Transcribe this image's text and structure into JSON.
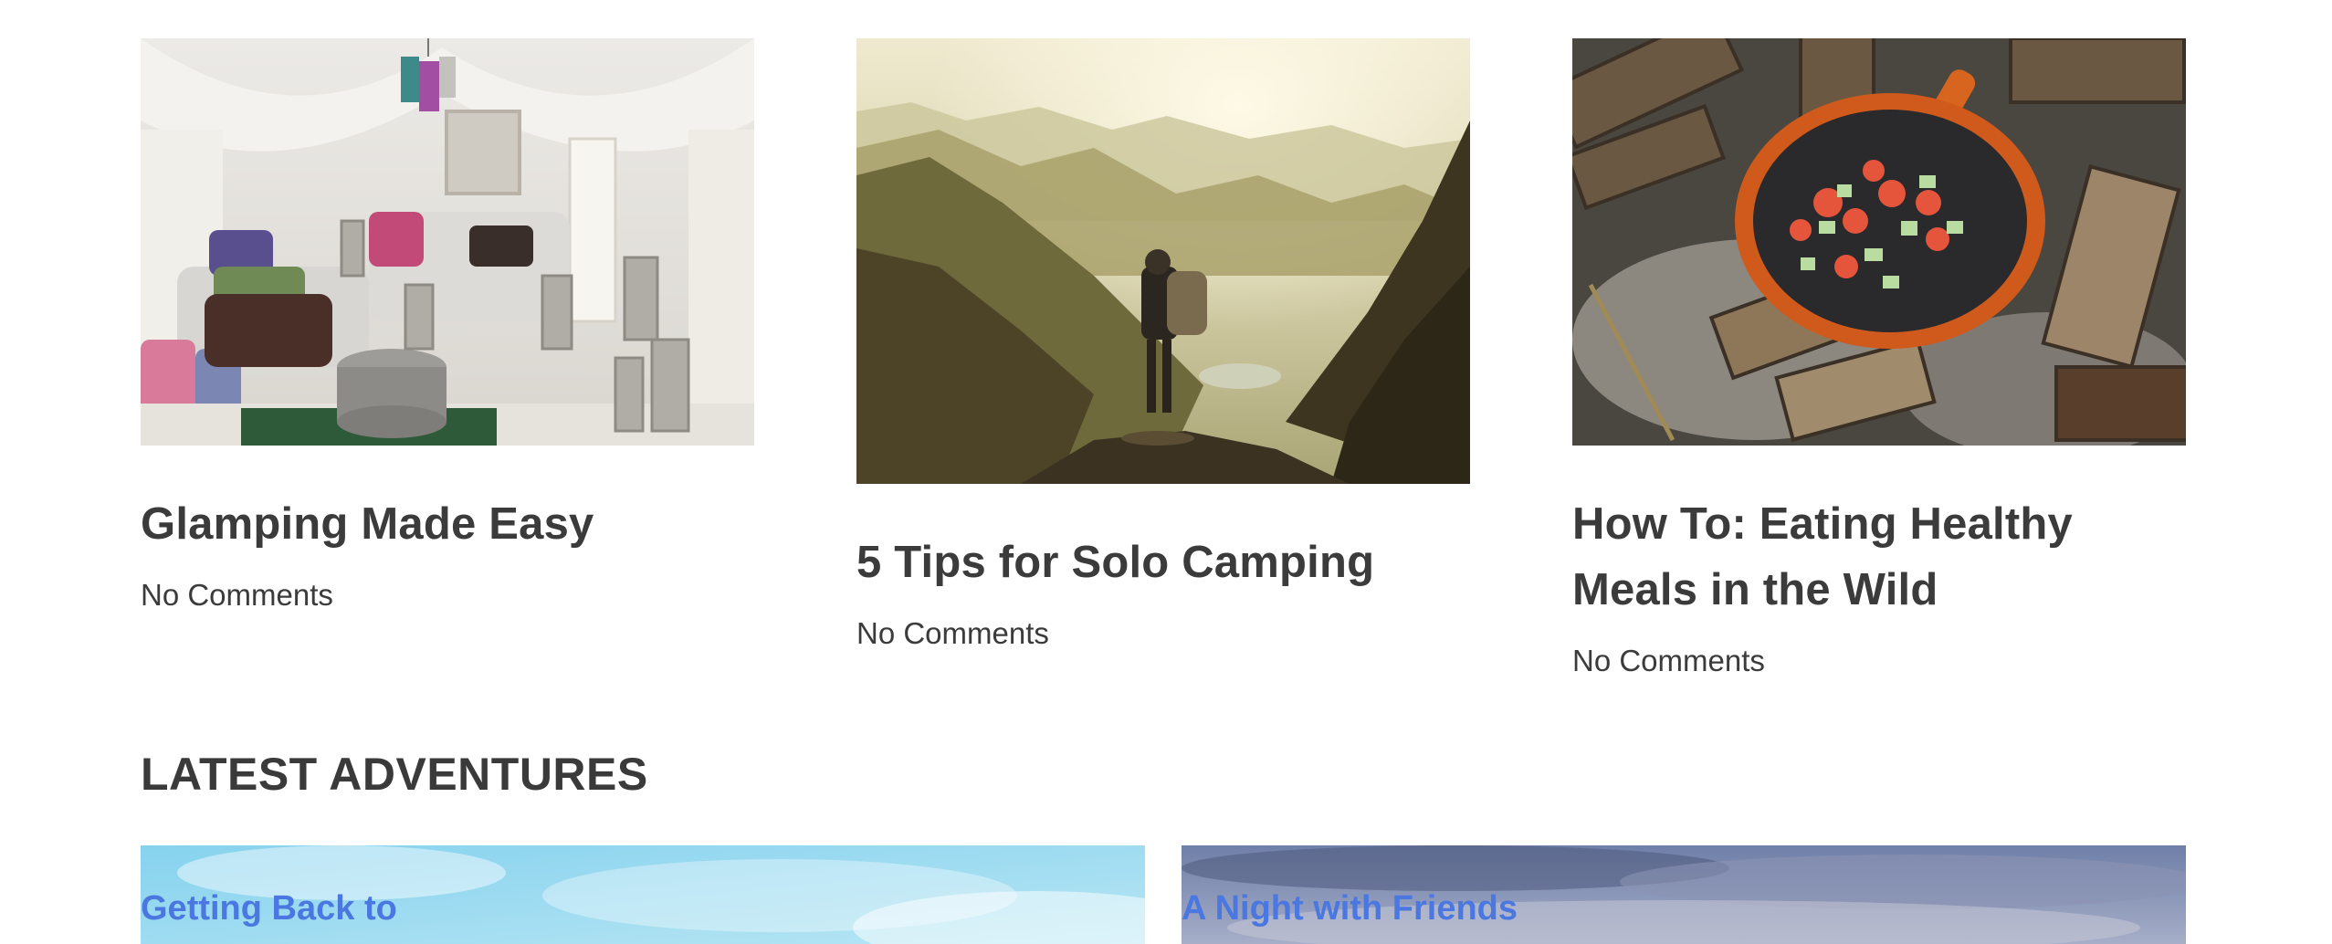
{
  "posts": [
    {
      "title": "Glamping Made Easy",
      "comments": "No Comments",
      "image": "glamping-tent-photo"
    },
    {
      "title": "5 Tips for Solo Camping",
      "comments": "No Comments",
      "image": "hiker-mountains-photo"
    },
    {
      "title": "How To: Eating Healthy Meals in the Wild",
      "comments": "No Comments",
      "image": "campfire-pan-photo"
    }
  ],
  "latest": {
    "heading": "LATEST ADVENTURES",
    "items": [
      {
        "title": "Getting Back to",
        "image": "sky-photo"
      },
      {
        "title": "A Night with Friends",
        "image": "dusk-sky-photo"
      }
    ]
  },
  "colors": {
    "text": "#3b3b3b",
    "link": "#4a78e0",
    "background": "#ffffff"
  }
}
